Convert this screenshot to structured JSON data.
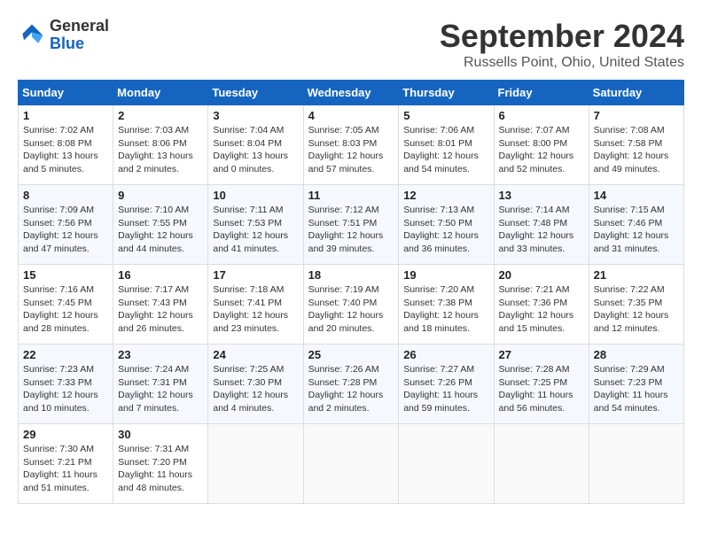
{
  "header": {
    "logo_line1": "General",
    "logo_line2": "Blue",
    "month": "September 2024",
    "location": "Russells Point, Ohio, United States"
  },
  "weekdays": [
    "Sunday",
    "Monday",
    "Tuesday",
    "Wednesday",
    "Thursday",
    "Friday",
    "Saturday"
  ],
  "weeks": [
    [
      {
        "day": "1",
        "detail": "Sunrise: 7:02 AM\nSunset: 8:08 PM\nDaylight: 13 hours\nand 5 minutes."
      },
      {
        "day": "2",
        "detail": "Sunrise: 7:03 AM\nSunset: 8:06 PM\nDaylight: 13 hours\nand 2 minutes."
      },
      {
        "day": "3",
        "detail": "Sunrise: 7:04 AM\nSunset: 8:04 PM\nDaylight: 13 hours\nand 0 minutes."
      },
      {
        "day": "4",
        "detail": "Sunrise: 7:05 AM\nSunset: 8:03 PM\nDaylight: 12 hours\nand 57 minutes."
      },
      {
        "day": "5",
        "detail": "Sunrise: 7:06 AM\nSunset: 8:01 PM\nDaylight: 12 hours\nand 54 minutes."
      },
      {
        "day": "6",
        "detail": "Sunrise: 7:07 AM\nSunset: 8:00 PM\nDaylight: 12 hours\nand 52 minutes."
      },
      {
        "day": "7",
        "detail": "Sunrise: 7:08 AM\nSunset: 7:58 PM\nDaylight: 12 hours\nand 49 minutes."
      }
    ],
    [
      {
        "day": "8",
        "detail": "Sunrise: 7:09 AM\nSunset: 7:56 PM\nDaylight: 12 hours\nand 47 minutes."
      },
      {
        "day": "9",
        "detail": "Sunrise: 7:10 AM\nSunset: 7:55 PM\nDaylight: 12 hours\nand 44 minutes."
      },
      {
        "day": "10",
        "detail": "Sunrise: 7:11 AM\nSunset: 7:53 PM\nDaylight: 12 hours\nand 41 minutes."
      },
      {
        "day": "11",
        "detail": "Sunrise: 7:12 AM\nSunset: 7:51 PM\nDaylight: 12 hours\nand 39 minutes."
      },
      {
        "day": "12",
        "detail": "Sunrise: 7:13 AM\nSunset: 7:50 PM\nDaylight: 12 hours\nand 36 minutes."
      },
      {
        "day": "13",
        "detail": "Sunrise: 7:14 AM\nSunset: 7:48 PM\nDaylight: 12 hours\nand 33 minutes."
      },
      {
        "day": "14",
        "detail": "Sunrise: 7:15 AM\nSunset: 7:46 PM\nDaylight: 12 hours\nand 31 minutes."
      }
    ],
    [
      {
        "day": "15",
        "detail": "Sunrise: 7:16 AM\nSunset: 7:45 PM\nDaylight: 12 hours\nand 28 minutes."
      },
      {
        "day": "16",
        "detail": "Sunrise: 7:17 AM\nSunset: 7:43 PM\nDaylight: 12 hours\nand 26 minutes."
      },
      {
        "day": "17",
        "detail": "Sunrise: 7:18 AM\nSunset: 7:41 PM\nDaylight: 12 hours\nand 23 minutes."
      },
      {
        "day": "18",
        "detail": "Sunrise: 7:19 AM\nSunset: 7:40 PM\nDaylight: 12 hours\nand 20 minutes."
      },
      {
        "day": "19",
        "detail": "Sunrise: 7:20 AM\nSunset: 7:38 PM\nDaylight: 12 hours\nand 18 minutes."
      },
      {
        "day": "20",
        "detail": "Sunrise: 7:21 AM\nSunset: 7:36 PM\nDaylight: 12 hours\nand 15 minutes."
      },
      {
        "day": "21",
        "detail": "Sunrise: 7:22 AM\nSunset: 7:35 PM\nDaylight: 12 hours\nand 12 minutes."
      }
    ],
    [
      {
        "day": "22",
        "detail": "Sunrise: 7:23 AM\nSunset: 7:33 PM\nDaylight: 12 hours\nand 10 minutes."
      },
      {
        "day": "23",
        "detail": "Sunrise: 7:24 AM\nSunset: 7:31 PM\nDaylight: 12 hours\nand 7 minutes."
      },
      {
        "day": "24",
        "detail": "Sunrise: 7:25 AM\nSunset: 7:30 PM\nDaylight: 12 hours\nand 4 minutes."
      },
      {
        "day": "25",
        "detail": "Sunrise: 7:26 AM\nSunset: 7:28 PM\nDaylight: 12 hours\nand 2 minutes."
      },
      {
        "day": "26",
        "detail": "Sunrise: 7:27 AM\nSunset: 7:26 PM\nDaylight: 11 hours\nand 59 minutes."
      },
      {
        "day": "27",
        "detail": "Sunrise: 7:28 AM\nSunset: 7:25 PM\nDaylight: 11 hours\nand 56 minutes."
      },
      {
        "day": "28",
        "detail": "Sunrise: 7:29 AM\nSunset: 7:23 PM\nDaylight: 11 hours\nand 54 minutes."
      }
    ],
    [
      {
        "day": "29",
        "detail": "Sunrise: 7:30 AM\nSunset: 7:21 PM\nDaylight: 11 hours\nand 51 minutes."
      },
      {
        "day": "30",
        "detail": "Sunrise: 7:31 AM\nSunset: 7:20 PM\nDaylight: 11 hours\nand 48 minutes."
      },
      null,
      null,
      null,
      null,
      null
    ]
  ]
}
